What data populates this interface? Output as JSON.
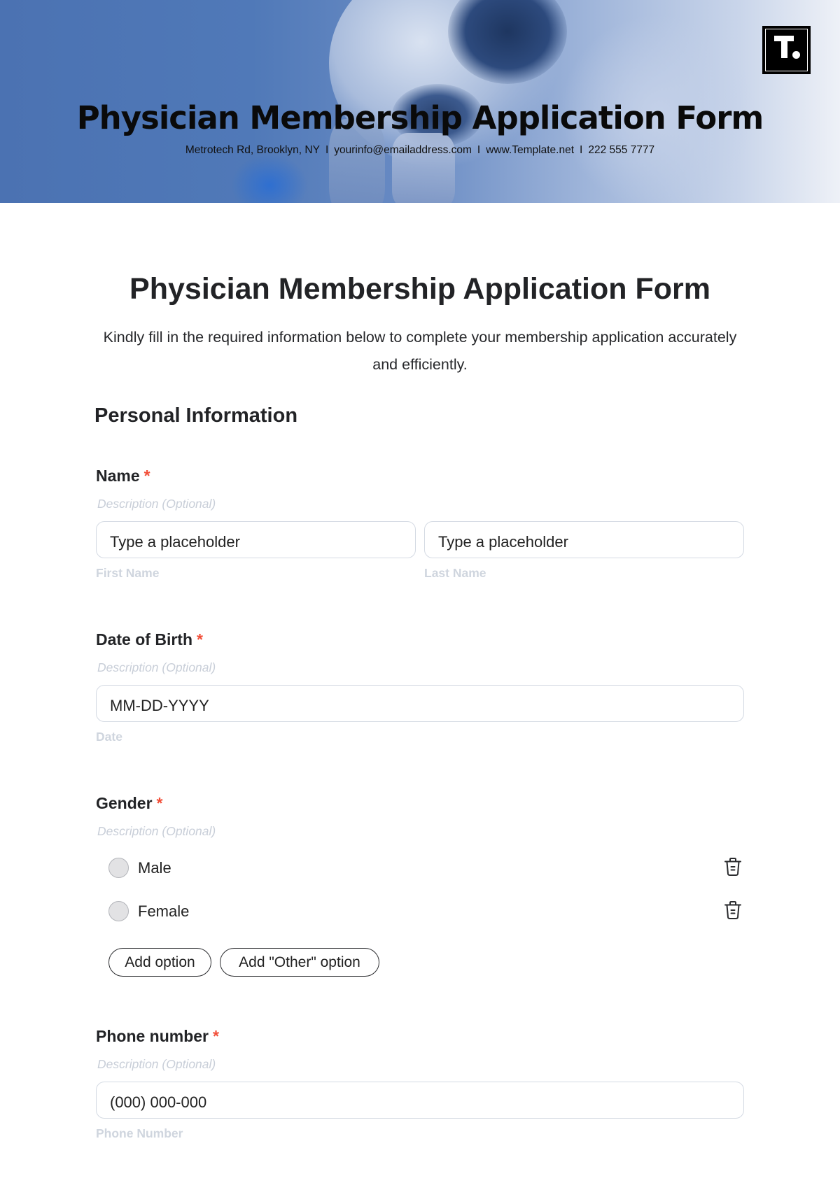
{
  "banner": {
    "title": "Physician Membership Application Form",
    "contact": {
      "address": "Metrotech Rd, Brooklyn, NY",
      "email": "yourinfo@emailaddress.com",
      "website": "www.Template.net",
      "phone": "222 555 7777",
      "separator": "I"
    },
    "logo_icon": "template-logo-icon",
    "background_color": "#4d74b3"
  },
  "form": {
    "title": "Physician Membership Application Form",
    "intro": "Kindly fill in the required information below to complete your membership application accurately and efficiently.",
    "required_marker": "*",
    "required_color": "#f24e38",
    "sections": [
      {
        "title": "Personal Information",
        "questions": [
          {
            "label": "Name",
            "required": true,
            "description": "Description (Optional)",
            "fields": [
              {
                "placeholder": "Type a placeholder",
                "caption": "First Name"
              },
              {
                "placeholder": "Type a placeholder",
                "caption": "Last Name"
              }
            ]
          },
          {
            "label": "Date of Birth",
            "required": true,
            "description": "Description (Optional)",
            "fields": [
              {
                "placeholder": "MM-DD-YYYY",
                "caption": "Date"
              }
            ]
          },
          {
            "label": "Gender",
            "required": true,
            "description": "Description (Optional)",
            "options": [
              {
                "label": "Male",
                "selected": false,
                "delete_icon": "trash-icon"
              },
              {
                "label": "Female",
                "selected": false,
                "delete_icon": "trash-icon"
              }
            ],
            "buttons": {
              "add_option": "Add option",
              "add_other_option": "Add \"Other\" option"
            }
          },
          {
            "label": "Phone number",
            "required": true,
            "description": "Description (Optional)",
            "fields": [
              {
                "placeholder": "(000) 000-000",
                "caption": "Phone Number"
              }
            ]
          }
        ]
      }
    ]
  }
}
